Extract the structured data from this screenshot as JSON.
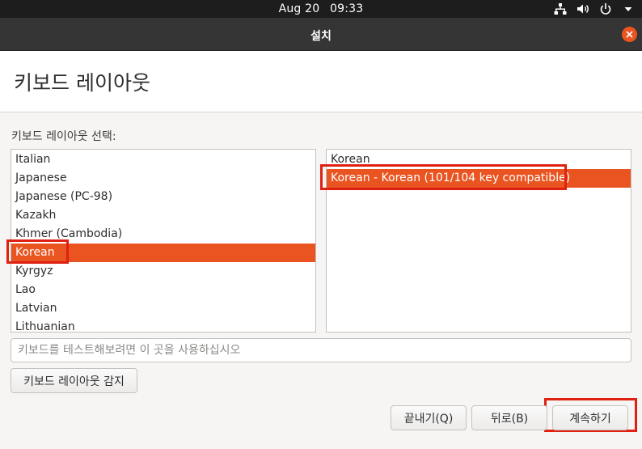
{
  "topbar": {
    "date": "Aug 20",
    "time": "09:33",
    "icons": [
      "network-icon",
      "volume-icon",
      "power-icon",
      "menu-arrow-icon"
    ]
  },
  "window": {
    "title": "설치"
  },
  "page": {
    "heading": "키보드 레이아웃",
    "layout_label": "키보드 레이아웃 선택:"
  },
  "layouts": [
    {
      "label": "Italian",
      "selected": false
    },
    {
      "label": "Japanese",
      "selected": false
    },
    {
      "label": "Japanese (PC-98)",
      "selected": false
    },
    {
      "label": "Kazakh",
      "selected": false
    },
    {
      "label": "Khmer (Cambodia)",
      "selected": false
    },
    {
      "label": "Korean",
      "selected": true
    },
    {
      "label": "Kyrgyz",
      "selected": false
    },
    {
      "label": "Lao",
      "selected": false
    },
    {
      "label": "Latvian",
      "selected": false
    },
    {
      "label": "Lithuanian",
      "selected": false
    }
  ],
  "variants": [
    {
      "label": "Korean",
      "selected": false
    },
    {
      "label": "Korean - Korean (101/104 key compatible)",
      "selected": true
    }
  ],
  "test_input": {
    "value": "",
    "placeholder": "키보드를 테스트해보려면 이 곳을 사용하십시오"
  },
  "buttons": {
    "detect": "키보드 레이아웃 감지",
    "quit": "끝내기(Q)",
    "back": "뒤로(B)",
    "next": "계속하기"
  },
  "colors": {
    "accent": "#e95420",
    "highlight_box": "#e02010"
  }
}
